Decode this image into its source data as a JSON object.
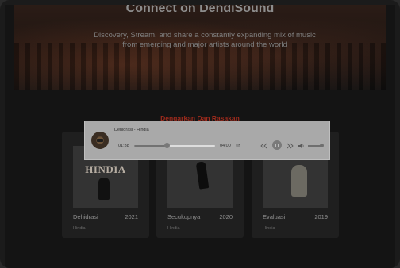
{
  "hero": {
    "title": "Connect on DendiSound",
    "subtitle_line1": "Discovery, Stream, and share a constantly expanding mix of music",
    "subtitle_line2": "from emerging and major artists around the world"
  },
  "section": {
    "title": "Dengarkan Dan Rasakan"
  },
  "albums": [
    {
      "title": "Dehidrasi",
      "year": "2021",
      "artist": "Hindia",
      "cover_text": "HINDIA"
    },
    {
      "title": "Secukupnya",
      "year": "2020",
      "artist": "Hindia"
    },
    {
      "title": "Evaluasi",
      "year": "2019",
      "artist": "Hindia"
    }
  ],
  "player": {
    "now_playing": "Dehidrasi - Hindia",
    "current_time": "01:38",
    "duration": "04:00",
    "progress_fraction": 0.4,
    "volume_fraction": 1.0,
    "icons": {
      "repeat": "repeat-icon",
      "previous": "previous-icon",
      "play_pause": "pause-icon",
      "next": "next-icon",
      "volume": "volume-icon"
    }
  },
  "colors": {
    "accent": "#9b2a1c",
    "player_bg": "#a9a9a9",
    "card_bg": "#1f1f1f",
    "page_bg": "#141414"
  }
}
